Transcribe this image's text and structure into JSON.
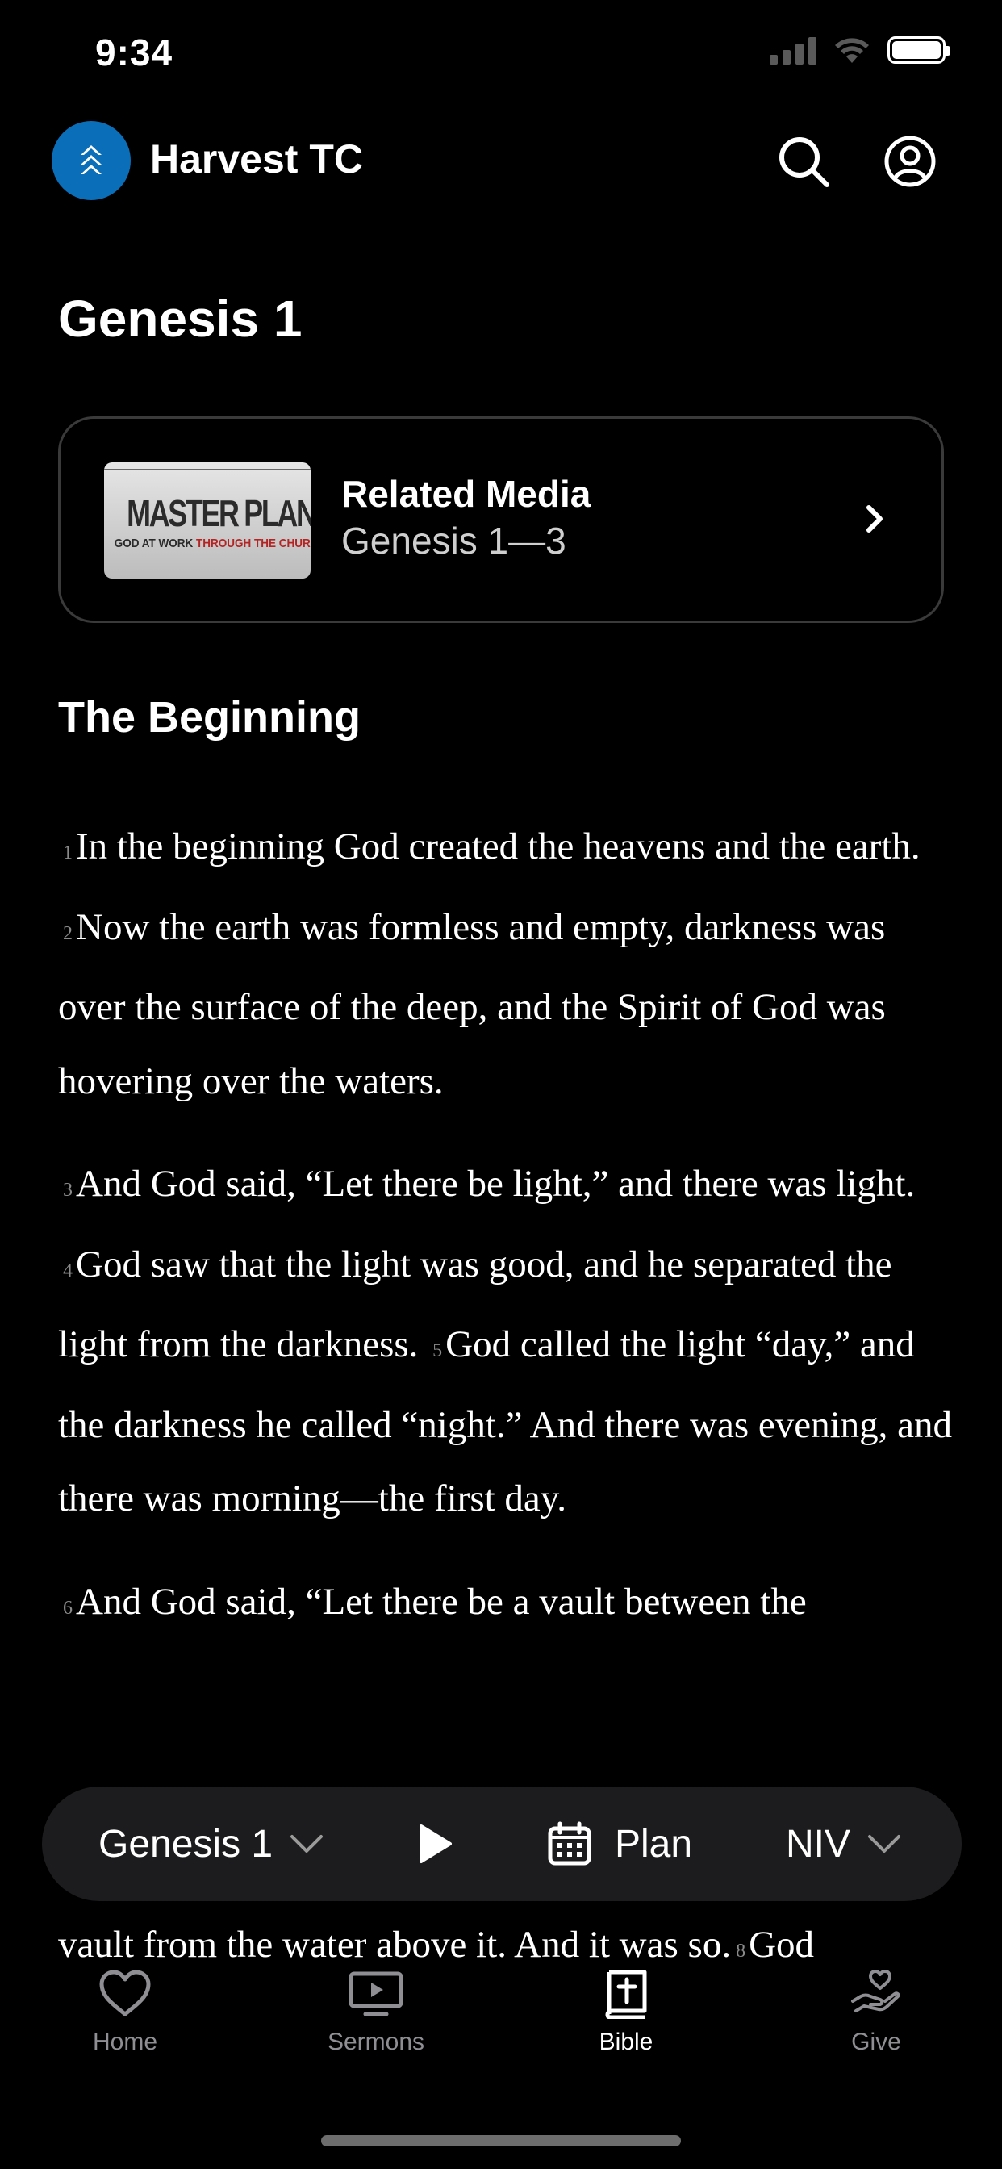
{
  "status_bar": {
    "time": "9:34"
  },
  "header": {
    "app_name": "Harvest TC",
    "accent": "#0a6fb8"
  },
  "page": {
    "title": "Genesis 1"
  },
  "related_media": {
    "title": "Related Media",
    "reference": "Genesis 1—3",
    "thumbnail_title": "MASTER PLAN",
    "thumbnail_subtitle_a": "GOD AT WORK ",
    "thumbnail_subtitle_b": "THROUGH THE CHURCH"
  },
  "section": {
    "heading": "The Beginning"
  },
  "scripture": {
    "paragraphs": [
      [
        {
          "num": "1",
          "text": "In the beginning God created the heavens and the earth."
        },
        {
          "num": "2",
          "text": "Now the earth was formless and empty, darkness was over the surface of the deep, and the Spirit of God was hovering over the waters."
        }
      ],
      [
        {
          "num": "3",
          "text": "And God said, “Let there be light,” and there was light."
        },
        {
          "num": "4",
          "text": "God saw that the light was good, and he separated the light from the darkness."
        },
        {
          "num": "5",
          "text": "God called the light “day,” and the darkness he called “night.” And there was evening, and there was morning—the first day."
        }
      ],
      [
        {
          "num": "6",
          "text": "And God said, “Let there be a vault between the"
        }
      ]
    ],
    "bottom_line_text": "vault from the water above it. And it was so.",
    "bottom_line_num": "8",
    "bottom_line_tail": "God"
  },
  "reader_toolbar": {
    "chapter": "Genesis 1",
    "plan_label": "Plan",
    "version": "NIV"
  },
  "tab_bar": {
    "tabs": [
      {
        "label": "Home",
        "icon": "heart-icon"
      },
      {
        "label": "Sermons",
        "icon": "video-icon"
      },
      {
        "label": "Bible",
        "icon": "bible-icon",
        "active": true
      },
      {
        "label": "Give",
        "icon": "give-icon"
      }
    ]
  }
}
